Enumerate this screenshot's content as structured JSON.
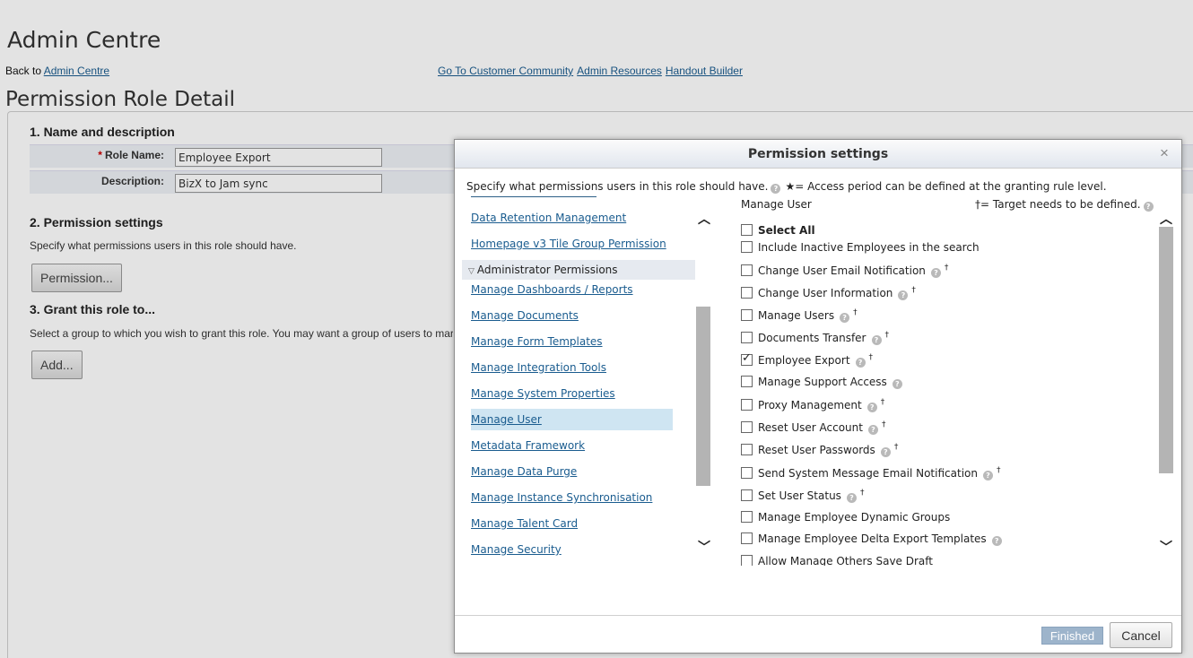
{
  "page": {
    "app_title": "Admin Centre",
    "back_prefix": "Back to",
    "back_link": "Admin Centre",
    "top_links": [
      "Go To Customer Community",
      "Admin Resources",
      "Handout Builder"
    ],
    "heading": "Permission Role Detail",
    "section1": {
      "title": "1. Name and description",
      "role_name_label": "Role Name:",
      "role_name_value": "Employee Export",
      "description_label": "Description:",
      "description_value": "BizX to Jam sync"
    },
    "section2": {
      "title": "2. Permission settings",
      "text": "Specify what permissions users in this role should have.",
      "button": "Permission..."
    },
    "section3": {
      "title": "3. Grant this role to...",
      "text": "Select a group to which you wish to grant this role. You may want a group of users to mar",
      "button": "Add..."
    }
  },
  "modal": {
    "title": "Permission settings",
    "intro": "Specify what permissions users in this role should have.",
    "star_note": "★= Access period can be defined at the granting rule level.",
    "target_note": "†= Target needs to be defined.",
    "nav": {
      "top_items": [
        "Data Retention Management",
        "Homepage v3 Tile Group Permission"
      ],
      "group": "Administrator Permissions",
      "items": [
        "Manage Dashboards / Reports",
        "Manage Documents",
        "Manage Form Templates",
        "Manage Integration Tools",
        "Manage System Properties",
        "Manage User",
        "Metadata Framework",
        "Manage Data Purge",
        "Manage Instance Synchronisation",
        "Manage Talent Card",
        "Manage Security"
      ],
      "active": "Manage User"
    },
    "section_title": "Manage User",
    "select_all": "Select All",
    "permissions": [
      {
        "label": "Include Inactive Employees in the search",
        "help": false,
        "target": false,
        "checked": false
      },
      {
        "label": "Change User Email Notification",
        "help": true,
        "target": true,
        "checked": false
      },
      {
        "label": "Change User Information",
        "help": true,
        "target": true,
        "checked": false
      },
      {
        "label": "Manage Users",
        "help": true,
        "target": true,
        "checked": false
      },
      {
        "label": "Documents Transfer",
        "help": true,
        "target": true,
        "checked": false
      },
      {
        "label": "Employee Export",
        "help": true,
        "target": true,
        "checked": true
      },
      {
        "label": "Manage Support Access",
        "help": true,
        "target": false,
        "checked": false
      },
      {
        "label": "Proxy Management",
        "help": true,
        "target": true,
        "checked": false
      },
      {
        "label": "Reset User Account",
        "help": true,
        "target": true,
        "checked": false
      },
      {
        "label": "Reset User Passwords",
        "help": true,
        "target": true,
        "checked": false
      },
      {
        "label": "Send System Message Email Notification",
        "help": true,
        "target": true,
        "checked": false
      },
      {
        "label": "Set User Status",
        "help": true,
        "target": true,
        "checked": false
      },
      {
        "label": "Manage Employee Dynamic Groups",
        "help": false,
        "target": false,
        "checked": false
      },
      {
        "label": "Manage Employee Delta Export Templates",
        "help": true,
        "target": false,
        "checked": false
      },
      {
        "label": "Allow Manage Others Save Draft",
        "help": false,
        "target": false,
        "checked": false
      }
    ],
    "finished_button": "Finished",
    "cancel_button": "Cancel",
    "help_glyph": "?",
    "dagger_glyph": "†",
    "close_glyph": "×",
    "up_glyph": "︿",
    "down_glyph": "﹀",
    "tri_glyph": "▽"
  },
  "colors": {
    "link": "#1a5c8f",
    "active_nav": "#cfe5f2",
    "finished_button": "#9db4cb",
    "required": "#cc0000"
  }
}
